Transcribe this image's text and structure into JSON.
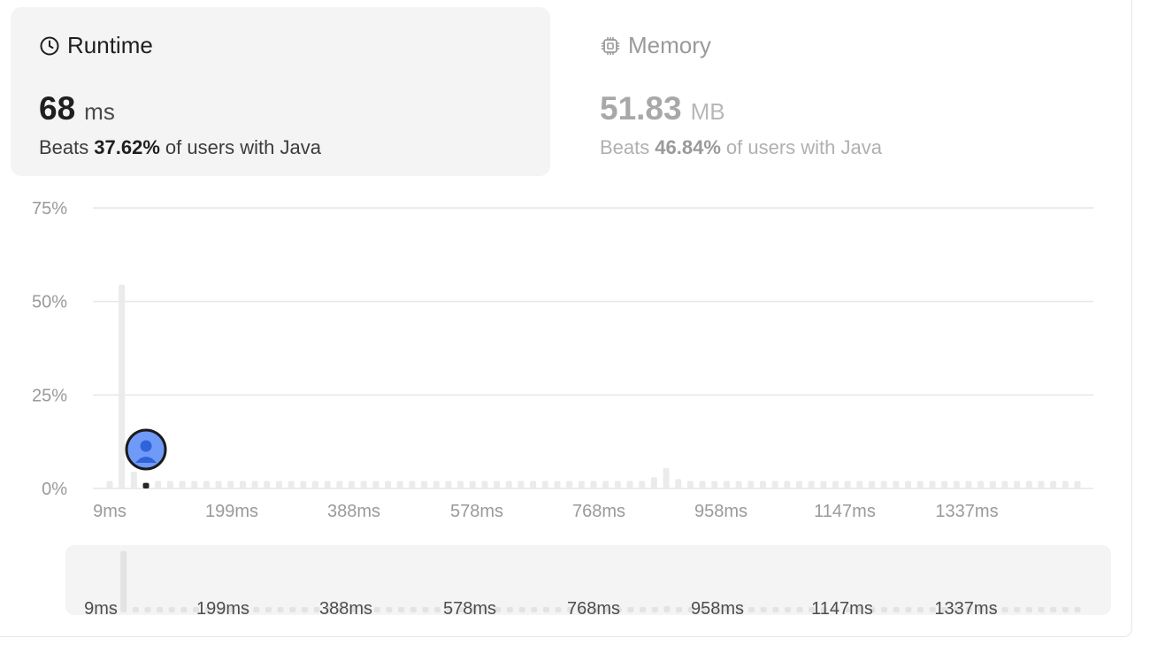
{
  "runtime": {
    "title": "Runtime",
    "value": "68",
    "unit": "ms",
    "beats_prefix": "Beats",
    "beats_value": "37.62%",
    "beats_suffix": "of users with Java",
    "icon": "clock-icon"
  },
  "memory": {
    "title": "Memory",
    "value": "51.83",
    "unit": "MB",
    "beats_prefix": "Beats",
    "beats_value": "46.84%",
    "beats_suffix": "of users with Java",
    "icon": "chip-icon"
  },
  "colors": {
    "card_active_bg": "#f4f4f4",
    "bar": "#ebebeb",
    "bar_user": "#262626",
    "avatar_fill": "#6f9af7",
    "grid": "#e6e6e6"
  },
  "chart_data": {
    "type": "bar",
    "title": "",
    "xlabel": "",
    "ylabel": "",
    "y_ticks": [
      "0%",
      "25%",
      "50%",
      "75%"
    ],
    "ylim": [
      0,
      75
    ],
    "x_tick_labels": [
      "9ms",
      "199ms",
      "388ms",
      "578ms",
      "768ms",
      "958ms",
      "1147ms",
      "1337ms"
    ],
    "x_start_ms": 9,
    "x_step_ms": 7,
    "values": [
      2.0,
      54.5,
      4.5,
      1.5,
      2.0,
      2.0,
      2.0,
      2.0,
      2.0,
      2.0,
      2.0,
      2.0,
      2.0,
      2.0,
      2.0,
      2.0,
      2.0,
      2.0,
      2.0,
      2.0,
      2.0,
      2.0,
      2.0,
      2.0,
      2.0,
      2.0,
      2.0,
      2.0,
      2.0,
      2.0,
      2.0,
      2.0,
      2.0,
      2.0,
      2.0,
      2.0,
      2.0,
      2.0,
      2.0,
      2.0,
      2.0,
      2.0,
      2.0,
      2.0,
      2.0,
      3.0,
      5.5,
      2.5,
      2.0,
      2.0,
      2.0,
      2.0,
      2.0,
      2.0,
      2.0,
      2.0,
      2.0,
      2.0,
      2.0,
      2.0,
      2.0,
      2.0,
      2.0,
      2.0,
      2.0,
      2.0,
      2.0,
      2.0,
      2.0,
      2.0,
      2.0,
      2.0,
      2.0,
      2.0,
      2.0,
      2.0,
      2.0,
      2.0,
      2.0,
      2.0,
      2.0
    ],
    "user_bar_index": 3,
    "user_value_ms": 68,
    "grid": true,
    "legend": "none"
  }
}
